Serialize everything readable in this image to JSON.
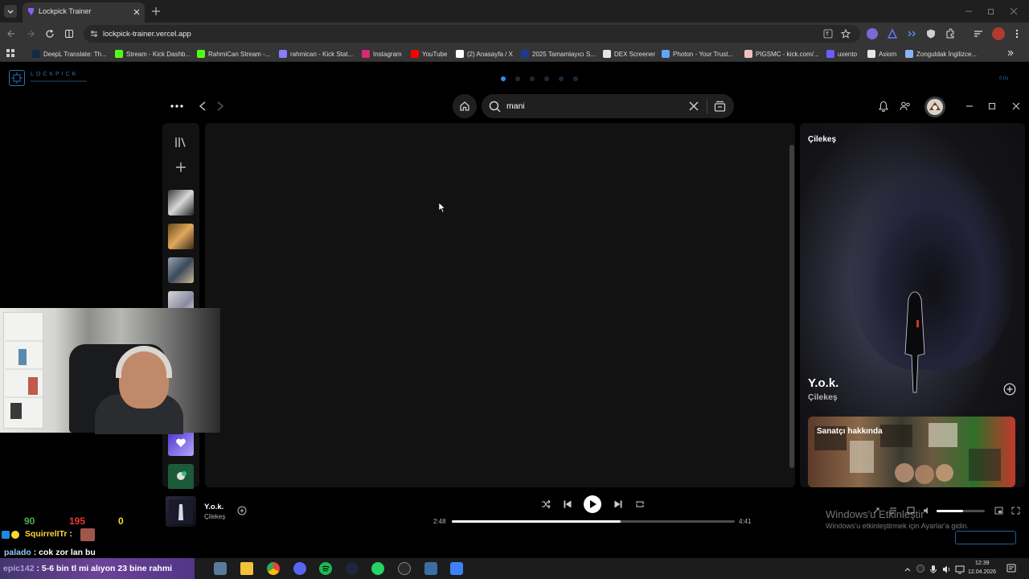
{
  "browser": {
    "tab_title": "Lockpick Trainer",
    "url": "lockpick-trainer.vercel.app",
    "bookmarks": [
      {
        "label": "DeepL Translate: Th...",
        "color": "#0f2b46"
      },
      {
        "label": "Stream - Kick Dashb...",
        "color": "#53fc18"
      },
      {
        "label": "RahmiCan Stream -...",
        "color": "#53fc18"
      },
      {
        "label": "rahmican - Kick Stat...",
        "color": "#8a7cff"
      },
      {
        "label": "Instagram",
        "color": "#d62976"
      },
      {
        "label": "YouTube",
        "color": "#ff0000"
      },
      {
        "label": "(2) Anasayfa / X",
        "color": "#ffffff"
      },
      {
        "label": "2025 Tamamlayıcı S...",
        "color": "#1e3a8a"
      },
      {
        "label": "DEX Screener",
        "color": "#e6e6e6"
      },
      {
        "label": "Photon - Your Trust...",
        "color": "#60a5fa"
      },
      {
        "label": "PIGSMC - kick.com/...",
        "color": "#f0c0c0"
      },
      {
        "label": "uxento",
        "color": "#6d5dfc"
      },
      {
        "label": "Axiom",
        "color": "#e6e6e6"
      },
      {
        "label": "Zonguldak İngilizce...",
        "color": "#8ab4f8"
      }
    ]
  },
  "lockpick": {
    "logo_text": "LOCKPICK",
    "version": "0.0s"
  },
  "spotify": {
    "search_query": "mani",
    "now_playing_panel": {
      "artist_heading": "Çilekeş",
      "track_title": "Y.o.k.",
      "track_artist": "Çilekeş",
      "about_label": "Sanatçı hakkında"
    },
    "player": {
      "track_title": "Y.o.k.",
      "track_artist": "Çilekeş",
      "elapsed": "2:48",
      "duration": "4:41",
      "progress": 0.597,
      "volume": 0.55
    }
  },
  "overlay": {
    "stats": [
      {
        "value": "90",
        "color": "#4caf50"
      },
      {
        "value": "195",
        "color": "#e53935"
      },
      {
        "value": "0",
        "color": "#fdd835"
      }
    ],
    "chat": [
      {
        "user": "SquirrelITr",
        "sep": " :",
        "text": "",
        "color": "#fdd835"
      },
      {
        "user": "palado",
        "sep": " :",
        "text": " cok zor lan bu",
        "color": "#90caf9"
      },
      {
        "user": "epic142",
        "sep": " :",
        "text": " 5-6 bin tl mi alıyon 23 bine rahmi",
        "color": "#b39ddb"
      }
    ]
  },
  "windows": {
    "watermark_title": "Windows'u Etkinleştir",
    "watermark_sub": "Windows'u etkinleştirmek için Ayarlar'a gidin.",
    "time": "12:39",
    "date": "12.04.2026"
  }
}
